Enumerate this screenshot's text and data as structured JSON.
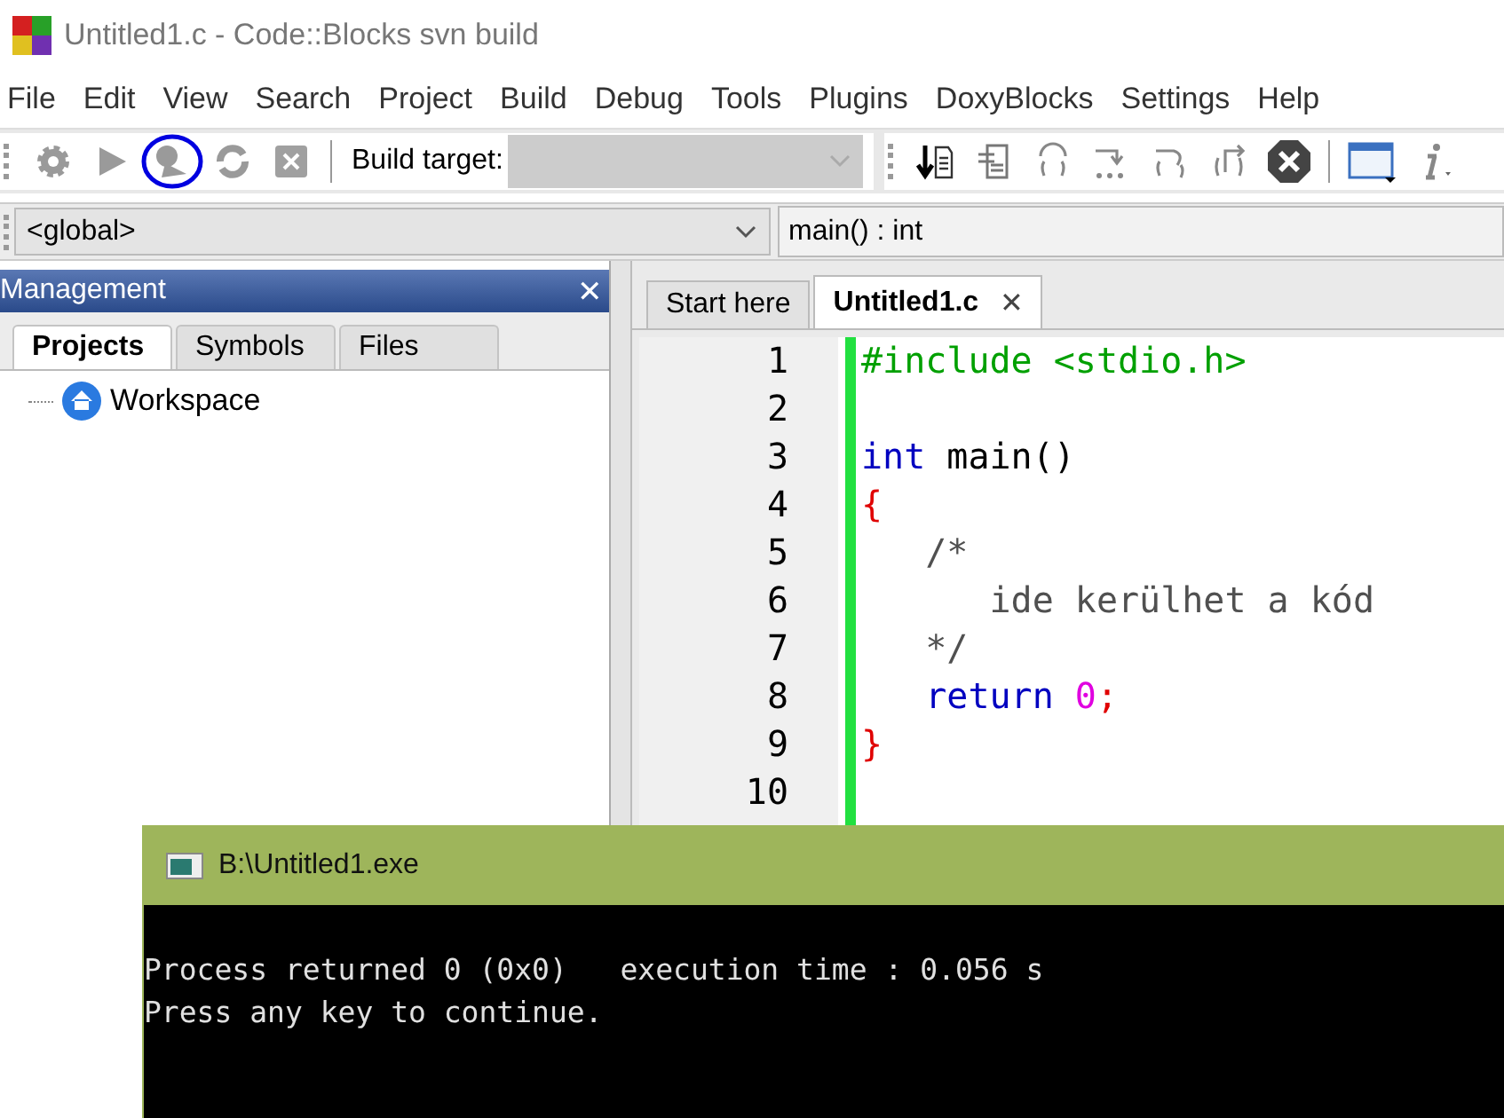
{
  "window": {
    "title": "Untitled1.c - Code::Blocks svn build"
  },
  "menu": [
    "File",
    "Edit",
    "View",
    "Search",
    "Project",
    "Build",
    "Debug",
    "Tools",
    "Plugins",
    "DoxyBlocks",
    "Settings",
    "Help"
  ],
  "toolbar": {
    "build_target_label": "Build target:"
  },
  "scope_bar": {
    "scope": "<global>",
    "function": "main() : int"
  },
  "management": {
    "title": "Management",
    "close": "✕",
    "tabs": [
      {
        "label": "Projects",
        "selected": true
      },
      {
        "label": "Symbols",
        "selected": false
      },
      {
        "label": "Files",
        "selected": false
      }
    ],
    "tree": [
      {
        "label": "Workspace"
      }
    ]
  },
  "editor": {
    "tabs": [
      {
        "label": "Start here",
        "selected": false
      },
      {
        "label": "Untitled1.c",
        "selected": true,
        "close": "✕"
      }
    ],
    "lines": [
      {
        "number": "1",
        "tokens": [
          {
            "kind": "preprocessor",
            "text": "#include <stdio.h>"
          }
        ]
      },
      {
        "number": "2"
      },
      {
        "number": "3",
        "tokens": [
          {
            "kind": "keyword",
            "text": "int"
          },
          {
            "kind": "plain",
            "text": " main()"
          }
        ]
      },
      {
        "number": "4",
        "tokens": [
          {
            "kind": "operator",
            "text": "{"
          }
        ]
      },
      {
        "number": "5",
        "tokens": [
          {
            "kind": "comment",
            "text": "   /*"
          }
        ]
      },
      {
        "number": "6",
        "tokens": [
          {
            "kind": "comment",
            "text": "      ide kerülhet a kód"
          }
        ]
      },
      {
        "number": "7",
        "tokens": [
          {
            "kind": "comment",
            "text": "   */"
          }
        ]
      },
      {
        "number": "8",
        "tokens": [
          {
            "kind": "keyword",
            "text": "   return"
          },
          {
            "kind": "number",
            "text": " 0"
          },
          {
            "kind": "operator",
            "text": ";"
          }
        ]
      },
      {
        "number": "9",
        "tokens": [
          {
            "kind": "operator",
            "text": "}"
          }
        ]
      },
      {
        "number": "10"
      }
    ]
  },
  "console": {
    "title": "B:\\Untitled1.exe",
    "output": [
      "Process returned 0 (0x0)   execution time : 0.056 s",
      "Press any key to continue."
    ]
  }
}
